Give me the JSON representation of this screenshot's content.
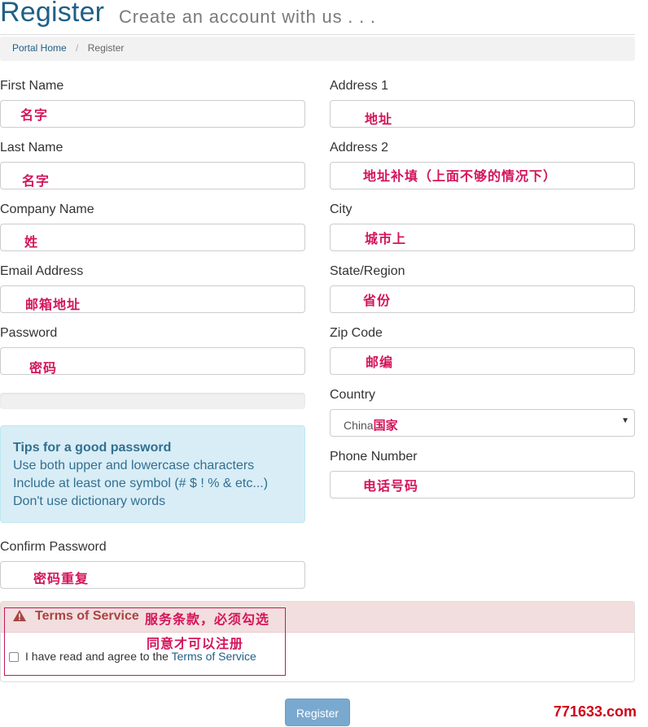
{
  "header": {
    "title": "Register",
    "subtitle": "Create an account with us . . ."
  },
  "breadcrumb": {
    "home": "Portal Home",
    "separator": "/",
    "current": "Register"
  },
  "fields": {
    "first_name": {
      "label": "First Name",
      "annotation": "名字"
    },
    "last_name": {
      "label": "Last Name",
      "annotation": "名字"
    },
    "company_name": {
      "label": "Company Name",
      "annotation": "姓"
    },
    "email": {
      "label": "Email Address",
      "annotation": "邮箱地址"
    },
    "password": {
      "label": "Password",
      "annotation": "密码"
    },
    "confirm_password": {
      "label": "Confirm Password",
      "annotation": "密码重复"
    },
    "address1": {
      "label": "Address 1",
      "annotation": "地址"
    },
    "address2": {
      "label": "Address 2",
      "annotation": "地址补填（上面不够的情况下）"
    },
    "city": {
      "label": "City",
      "annotation": "城市上"
    },
    "state": {
      "label": "State/Region",
      "annotation": "省份"
    },
    "zip": {
      "label": "Zip Code",
      "annotation": "邮编"
    },
    "country": {
      "label": "Country",
      "value": "China",
      "annotation": "国家"
    },
    "phone": {
      "label": "Phone Number",
      "annotation": "电话号码"
    }
  },
  "password_tips": {
    "title": "Tips for a good password",
    "lines": [
      "Use both upper and lowercase characters",
      "Include at least one symbol (# $ ! % & etc...)",
      "Don't use dictionary words"
    ]
  },
  "terms": {
    "title": "Terms of Service",
    "annotation_line1": "服务条款，必须勾选",
    "annotation_line2": "同意才可以注册",
    "agree_text": "I have read and agree to the",
    "agree_link": "Terms of Service",
    "checked": false
  },
  "actions": {
    "register_label": "Register"
  },
  "watermark": "771633.com",
  "colors": {
    "brand": "#1f5f86",
    "annotation": "#d4145a",
    "tips_bg": "#d9edf7",
    "danger_bg": "#f2dede",
    "button": "#7aa9cf"
  }
}
